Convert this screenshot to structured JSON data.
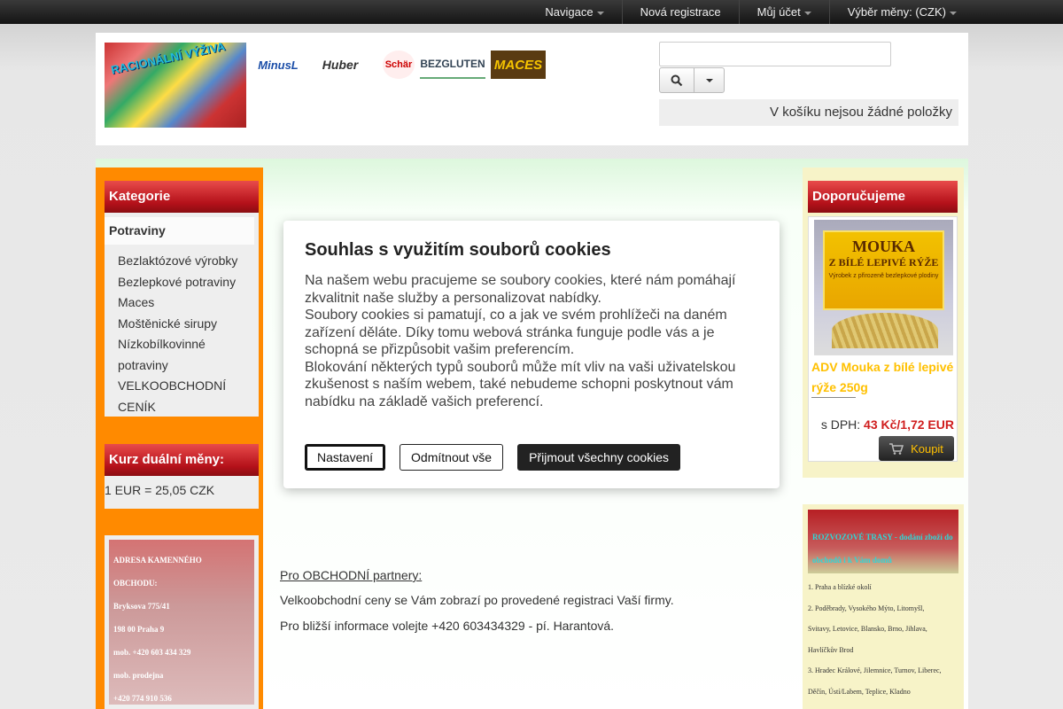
{
  "topnav": {
    "navigace": "Navigace",
    "nova_registrace": "Nová registrace",
    "muj_ucet": "Můj účet",
    "vyber_meny": "Výběr měny: (CZK)"
  },
  "header": {
    "photo_title": "RACIONÁLNÍ VÝŽIVA",
    "logos": {
      "minus": "MinusL",
      "huber": "Huber",
      "schar": "Schär",
      "bezgluten": "BEZGLUTEN",
      "maces": "MACES"
    },
    "search": {
      "value": ""
    },
    "cart_text": "V košíku nejsou žádné položky"
  },
  "sidebar": {
    "categories_title": "Kategorie",
    "active_category": "Potraviny",
    "subcategories": [
      "Bezlaktózové výrobky",
      "Bezlepkové potraviny",
      "Maces",
      "Moštěnické sirupy",
      "Nízkobílkovinné",
      "potraviny",
      "VELKOOBCHODNÍ",
      "CENÍK"
    ],
    "rate_title": "Kurz duální měny:",
    "rate_value": "1 EUR = 25,05 CZK",
    "address": [
      "ADRESA KAMENNÉHO",
      "OBCHODU:",
      "Bryksova 775/41",
      "198 00 Praha 9",
      "mob. +420 603 434 329",
      "mob. prodejna",
      "+420 774 910 536"
    ]
  },
  "content": {
    "partners_title": "Pro OBCHODNÍ  partnery:",
    "partners_line2": "Velkoobchodní ceny se Vám zobrazí po provedené registraci Vaší firmy.",
    "partners_line3": "Pro bližší informace volejte  +420 603434329 - pí. Harantová."
  },
  "recommend": {
    "title": "Doporučujeme",
    "product_label_1": "MOUKA",
    "product_label_2": "Z BÍLÉ LEPIVÉ RÝŽE",
    "product_label_3": "Výrobek z přirozeně bezlepkové plodiny",
    "product_name": "ADV Mouka z bílé lepivé rýže 250g",
    "price_prefix": "s DPH:",
    "price_value": "43 Kč/1,72 EUR",
    "buy_label": "Koupit"
  },
  "routes": {
    "title": "ROZVOZOVÉ  TRASY - dodání zboží do obchodů i k Vám domů",
    "items": [
      "1. Praha a blízké okolí",
      "2. Poděbrady, Vysokého Mýto, Litomyšl,",
      "Svitavy, Letovice, Blansko, Brno, Jihlava,",
      "Havlíčkův Brod",
      "3. Hradec Králové, Jilemnice, Turnov, Liberec,",
      "Děčín, Ústí/Labem, Teplice, Kladno"
    ]
  },
  "cookie_modal": {
    "title": "Souhlas s využitím souborů cookies",
    "paragraphs": [
      "Na našem webu pracujeme se soubory cookies, které nám pomáhají zkvalitnit naše služby a personalizovat nabídky.",
      "Soubory cookies si pamatují, co a jak ve svém prohlížeči na daném zařízení děláte. Díky tomu webová stránka funguje podle vás a je schopná se přizpůsobit vašim preferencím.",
      "Blokování některých typů souborů může mít vliv na vaši uživatelskou zkušenost s naším webem, také nebudeme schopni poskytnout vám nabídku na základě vašich preferencí."
    ],
    "btn_settings": "Nastavení",
    "btn_reject": "Odmítnout vše",
    "btn_accept": "Přijmout všechny cookies"
  },
  "colors": {
    "accent_orange": "#ff8a00",
    "panel_red": "#b5111a",
    "product_yellow": "#ffc000",
    "price_red": "#d01e1e"
  }
}
